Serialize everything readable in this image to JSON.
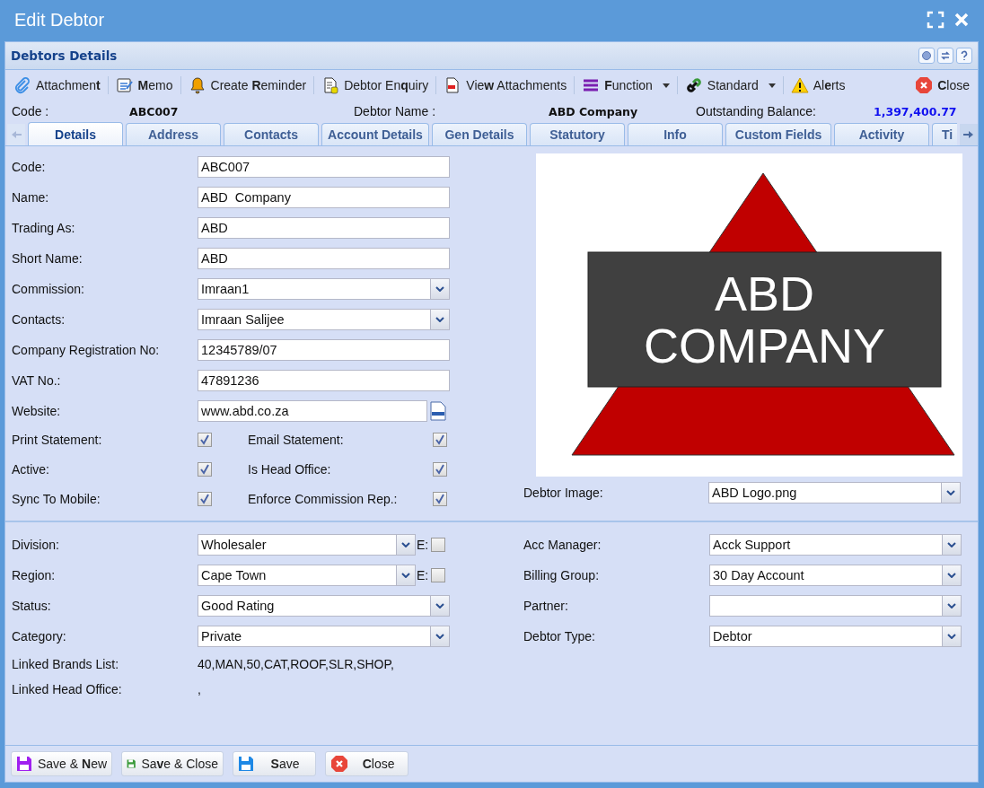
{
  "window": {
    "title": "Edit Debtor"
  },
  "panel": {
    "title": "Debtors Details"
  },
  "toolbar": [
    {
      "label": "Attachmen**t**",
      "dropdown": false
    },
    {
      "label": "**M**emo",
      "dropdown": false
    },
    {
      "label": "Create **R**eminder",
      "dropdown": false
    },
    {
      "label": "Debtor En**q**uiry",
      "dropdown": false
    },
    {
      "label": "Vie**w** Attachments",
      "dropdown": false
    },
    {
      "label": "**F**unction",
      "dropdown": true
    },
    {
      "label": "Standard",
      "dropdown": true
    },
    {
      "label": "Al**e**rts",
      "dropdown": false
    },
    {
      "label": "**C**lose",
      "dropdown": false
    }
  ],
  "summary": {
    "code_label": "Code :",
    "code": "ABC007",
    "name_label": "Debtor Name :",
    "name": "ABD Company",
    "balance_label": "Outstanding Balance:",
    "balance": "1,397,400.77"
  },
  "tabs": [
    {
      "label": "Details",
      "selected": true
    },
    {
      "label": "Address",
      "selected": false
    },
    {
      "label": "Contacts",
      "selected": false
    },
    {
      "label": "Account Details",
      "selected": false
    },
    {
      "label": "Gen Details",
      "selected": false
    },
    {
      "label": "Statutory",
      "selected": false
    },
    {
      "label": "Info",
      "selected": false
    },
    {
      "label": "Custom Fields",
      "selected": false
    },
    {
      "label": "Activity",
      "selected": false
    },
    {
      "label": "Ti",
      "selected": false
    }
  ],
  "fields": [
    {
      "label": "Code:",
      "value": "ABC007",
      "kind": "text"
    },
    {
      "label": "Name:",
      "value": "ABD  Company",
      "kind": "text"
    },
    {
      "label": "Trading As:",
      "value": "ABD",
      "kind": "text"
    },
    {
      "label": "Short Name:",
      "value": "ABD",
      "kind": "text"
    },
    {
      "label": "Commission:",
      "value": "Imraan1",
      "kind": "select"
    },
    {
      "label": "Contacts:",
      "value": "Imraan Salijee",
      "kind": "select"
    },
    {
      "label": "Company Registration No:",
      "value": "12345789/07",
      "kind": "text"
    },
    {
      "label": "VAT No.:",
      "value": "47891236",
      "kind": "text"
    },
    {
      "label": "Website:",
      "value": "www.abd.co.za",
      "kind": "website"
    }
  ],
  "checks": [
    {
      "label": "Print Statement:",
      "checked": true
    },
    {
      "label": "Email Statement:",
      "checked": true
    },
    {
      "label": "Active:",
      "checked": true
    },
    {
      "label": "Is Head Office:",
      "checked": true
    },
    {
      "label": "Sync To Mobile:",
      "checked": true
    },
    {
      "label": "Enforce Commission Rep.:",
      "checked": true
    }
  ],
  "logo": {
    "lines": [
      "ABD",
      "COMPANY"
    ]
  },
  "image_field": {
    "label": "Debtor Image:",
    "value": "ABD Logo.png"
  },
  "lower_left": [
    {
      "label": "Division:",
      "value": "Wholesaler",
      "extra_label": "E:",
      "extra_checked": false
    },
    {
      "label": "Region:",
      "value": "Cape Town",
      "extra_label": "E:",
      "extra_checked": false
    },
    {
      "label": "Status:",
      "value": "Good Rating"
    },
    {
      "label": "Category:",
      "value": "Private"
    }
  ],
  "lower_right": [
    {
      "label": "Acc Manager:",
      "value": "Acck Support"
    },
    {
      "label": "Billing Group:",
      "value": "30 Day Account"
    },
    {
      "label": "Partner:"
    },
    {
      "label": "Debtor Type:",
      "value": "Debtor"
    }
  ],
  "links": [
    {
      "label": "Linked Brands List:",
      "value": "40,MAN,50,CAT,ROOF,SLR,SHOP,"
    },
    {
      "label": "Linked Head Office:",
      "value": ","
    }
  ],
  "footer": [
    {
      "label": "Save & **N**ew"
    },
    {
      "label": "Sa**v**e & Close"
    },
    {
      "label": "**S**ave"
    },
    {
      "label": "**C**lose"
    }
  ]
}
